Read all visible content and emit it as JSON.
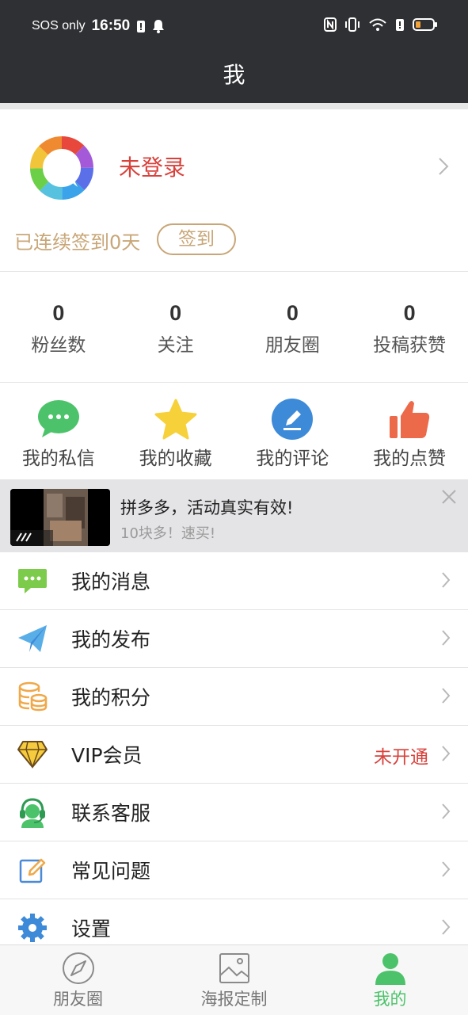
{
  "status_bar": {
    "carrier": "SOS only",
    "time": "16:50"
  },
  "header": {
    "title": "我"
  },
  "profile": {
    "login_status": "未登录",
    "signin_streak": "已连续签到0天",
    "signin_button": "签到"
  },
  "stats": [
    {
      "value": "0",
      "label": "粉丝数"
    },
    {
      "value": "0",
      "label": "关注"
    },
    {
      "value": "0",
      "label": "朋友圈"
    },
    {
      "value": "0",
      "label": "投稿获赞"
    }
  ],
  "quick_actions": [
    {
      "label": "我的私信",
      "icon": "chat-bubble-icon"
    },
    {
      "label": "我的收藏",
      "icon": "star-icon"
    },
    {
      "label": "我的评论",
      "icon": "pen-icon"
    },
    {
      "label": "我的点赞",
      "icon": "thumbs-up-icon"
    }
  ],
  "ad": {
    "title": "拼多多，活动真实有效!",
    "subtitle": "10块多！速买!"
  },
  "menu": [
    {
      "label": "我的消息",
      "icon": "message-icon"
    },
    {
      "label": "我的发布",
      "icon": "paper-plane-icon"
    },
    {
      "label": "我的积分",
      "icon": "coins-icon"
    },
    {
      "label": "VIP会员",
      "icon": "diamond-icon",
      "value": "未开通"
    },
    {
      "label": "联系客服",
      "icon": "headset-icon"
    },
    {
      "label": "常见问题",
      "icon": "edit-icon"
    },
    {
      "label": "设置",
      "icon": "gear-icon"
    }
  ],
  "tabs": [
    {
      "label": "朋友圈",
      "icon": "compass-icon"
    },
    {
      "label": "海报定制",
      "icon": "picture-icon"
    },
    {
      "label": "我的",
      "icon": "person-icon",
      "active": true
    }
  ],
  "colors": {
    "accent_green": "#4cc36a",
    "alert_red": "#d9413b",
    "gold": "#c8a677",
    "header_bg": "#2f3033"
  }
}
